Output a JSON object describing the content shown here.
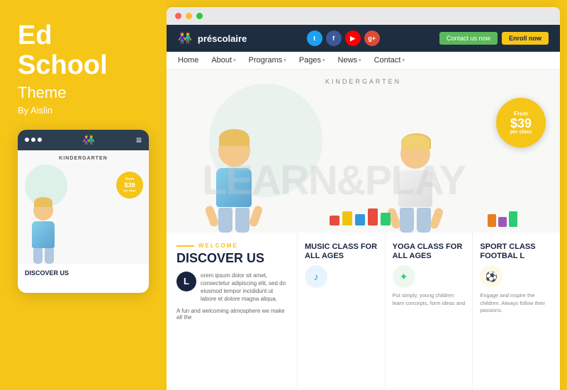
{
  "left": {
    "title_line1": "Ed",
    "title_line2": "School",
    "subtitle": "Theme",
    "by": "By Aislin"
  },
  "mobile": {
    "kindergarten_label": "KINDERGARTEN",
    "price_from": "From",
    "price_value": "$39",
    "price_per": "per class",
    "discover": "DISCOVER US"
  },
  "browser": {
    "brand": "préscolaire",
    "social": [
      "t",
      "f",
      "▶",
      "g+"
    ],
    "contact_label": "Contact us now",
    "enroll_label": "Enroll now",
    "nav_items": [
      {
        "label": "Home",
        "has_arrow": false
      },
      {
        "label": "About",
        "has_arrow": true
      },
      {
        "label": "Programs",
        "has_arrow": true
      },
      {
        "label": "Pages",
        "has_arrow": true
      },
      {
        "label": "News",
        "has_arrow": true
      },
      {
        "label": "Contact",
        "has_arrow": true
      }
    ],
    "hero_label": "KINDERGARTEN",
    "hero_text": "LEARN&PLAY",
    "price_from": "From",
    "price_value": "$39",
    "price_per": "per class"
  },
  "bottom": {
    "welcome_label": "WELCOME",
    "discover_title": "DISCOVER US",
    "discover_letter": "L",
    "discover_body": "orem ipsum dolor sit amet, consectetur adipiscing elit, sed do eiusmod tempor incididunt ut labore et dolore magna aliqua.",
    "read_more": "A fun and welcoming atmosphere we make all the"
  },
  "info_cards": [
    {
      "title": "MUSIC CLASS FOR ALL AGES",
      "icon": "♪",
      "icon_class": "icon-music",
      "text": ""
    },
    {
      "title": "YOGA CLASS FOR ALL AGES",
      "icon": "✦",
      "icon_class": "icon-yoga",
      "text": "Put simply, young children learn concepts, form ideas and"
    },
    {
      "title": "SPORT CLASS FOOTBAL L",
      "icon": "⚽",
      "icon_class": "icon-sport",
      "text": "Engage and inspire the children. Always follow their passions."
    }
  ]
}
